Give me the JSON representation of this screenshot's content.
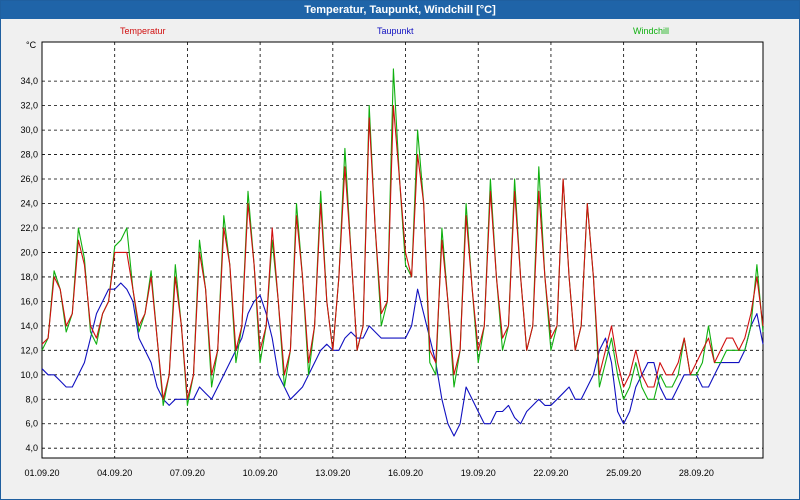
{
  "window": {
    "title": "Temperatur, Taupunkt, Windchill [°C]"
  },
  "colors": {
    "temperature": "#d01010",
    "dewpoint": "#1010c0",
    "windchill": "#10b010"
  },
  "chart_data": {
    "type": "line",
    "title": "Temperatur, Taupunkt, Windchill [°C]",
    "ylabel": "°C",
    "ylim": [
      3.2,
      37.2
    ],
    "xlim": [
      0,
      29.75
    ],
    "yticks": [
      4,
      6,
      8,
      10,
      12,
      14,
      16,
      18,
      20,
      22,
      24,
      26,
      28,
      30,
      32,
      34
    ],
    "ytick_labels": [
      "4,0",
      "6,0",
      "8,0",
      "10,0",
      "12,0",
      "14,0",
      "16,0",
      "18,0",
      "20,0",
      "22,0",
      "24,0",
      "26,0",
      "28,0",
      "30,0",
      "32,0",
      "34,0"
    ],
    "xticks": [
      0,
      3,
      6,
      9,
      12,
      15,
      18,
      21,
      24,
      27
    ],
    "xtick_labels": [
      "01.09.20",
      "04.09.20",
      "07.09.20",
      "10.09.20",
      "13.09.20",
      "16.09.20",
      "19.09.20",
      "22.09.20",
      "25.09.20",
      "28.09.20"
    ],
    "grid": true,
    "legend_position": "top",
    "series": [
      {
        "name": "Temperatur",
        "x": [
          0,
          0.25,
          0.5,
          0.75,
          1,
          1.25,
          1.5,
          1.75,
          2,
          2.25,
          2.5,
          2.75,
          3,
          3.25,
          3.5,
          3.75,
          4,
          4.25,
          4.5,
          4.75,
          5,
          5.25,
          5.5,
          5.75,
          6,
          6.25,
          6.5,
          6.75,
          7,
          7.25,
          7.5,
          7.75,
          8,
          8.25,
          8.5,
          8.75,
          9,
          9.25,
          9.5,
          9.75,
          10,
          10.25,
          10.5,
          10.75,
          11,
          11.25,
          11.5,
          11.75,
          12,
          12.25,
          12.5,
          12.75,
          13,
          13.25,
          13.5,
          13.75,
          14,
          14.25,
          14.5,
          14.75,
          15,
          15.25,
          15.5,
          15.75,
          16,
          16.25,
          16.5,
          16.75,
          17,
          17.25,
          17.5,
          17.75,
          18,
          18.25,
          18.5,
          18.75,
          19,
          19.25,
          19.5,
          19.75,
          20,
          20.25,
          20.5,
          20.75,
          21,
          21.25,
          21.5,
          21.75,
          22,
          22.25,
          22.5,
          22.75,
          23,
          23.25,
          23.5,
          23.75,
          24,
          24.25,
          24.5,
          24.75,
          25,
          25.25,
          25.5,
          25.75,
          26,
          26.25,
          26.5,
          26.75,
          27,
          27.25,
          27.5,
          27.75,
          28,
          28.25,
          28.5,
          28.75,
          29,
          29.25,
          29.5,
          29.75
        ],
        "values": [
          12.5,
          13,
          18,
          17,
          14,
          15,
          21,
          19,
          14,
          13,
          15,
          16,
          20,
          20,
          20,
          17,
          14,
          15,
          18,
          13,
          8,
          10,
          18,
          14,
          8,
          10,
          20,
          17,
          10,
          12,
          22,
          19,
          12,
          14,
          24,
          19,
          12,
          14,
          22,
          16,
          10,
          12,
          23,
          18,
          11,
          14,
          24,
          16,
          12,
          18,
          27,
          20,
          12,
          14,
          31,
          22,
          15,
          16,
          32,
          26,
          20,
          18,
          28,
          24,
          12,
          11,
          21,
          16,
          10,
          12,
          23,
          17,
          12,
          14,
          25,
          18,
          13,
          14,
          25,
          18,
          12,
          14,
          25,
          18,
          13,
          14,
          26,
          18,
          12,
          14,
          24,
          18,
          10,
          12,
          14,
          11,
          9,
          10,
          12,
          10,
          9,
          9,
          11,
          10,
          10,
          11,
          13,
          10,
          11,
          12,
          13,
          11,
          12,
          13,
          13,
          12,
          13,
          15,
          18,
          14
        ],
        "color": "#d01010"
      },
      {
        "name": "Taupunkt",
        "x": [
          0,
          0.25,
          0.5,
          0.75,
          1,
          1.25,
          1.5,
          1.75,
          2,
          2.25,
          2.5,
          2.75,
          3,
          3.25,
          3.5,
          3.75,
          4,
          4.25,
          4.5,
          4.75,
          5,
          5.25,
          5.5,
          5.75,
          6,
          6.25,
          6.5,
          6.75,
          7,
          7.25,
          7.5,
          7.75,
          8,
          8.25,
          8.5,
          8.75,
          9,
          9.25,
          9.5,
          9.75,
          10,
          10.25,
          10.5,
          10.75,
          11,
          11.25,
          11.5,
          11.75,
          12,
          12.25,
          12.5,
          12.75,
          13,
          13.25,
          13.5,
          13.75,
          14,
          14.25,
          14.5,
          14.75,
          15,
          15.25,
          15.5,
          15.75,
          16,
          16.25,
          16.5,
          16.75,
          17,
          17.25,
          17.5,
          17.75,
          18,
          18.25,
          18.5,
          18.75,
          19,
          19.25,
          19.5,
          19.75,
          20,
          20.25,
          20.5,
          20.75,
          21,
          21.25,
          21.5,
          21.75,
          22,
          22.25,
          22.5,
          22.75,
          23,
          23.25,
          23.5,
          23.75,
          24,
          24.25,
          24.5,
          24.75,
          25,
          25.25,
          25.5,
          25.75,
          26,
          26.25,
          26.5,
          26.75,
          27,
          27.25,
          27.5,
          27.75,
          28,
          28.25,
          28.5,
          28.75,
          29,
          29.25,
          29.5,
          29.75
        ],
        "values": [
          10.5,
          10,
          10,
          9.5,
          9,
          9,
          10,
          11,
          13,
          15,
          16,
          17,
          17,
          17.5,
          17,
          16,
          13,
          12,
          11,
          9,
          8,
          7.5,
          8,
          8,
          8,
          8,
          9,
          8.5,
          8,
          9,
          10,
          11,
          12,
          13,
          15,
          16,
          16.5,
          15,
          13,
          10,
          9,
          8,
          8.5,
          9,
          10,
          11,
          12,
          12.5,
          12,
          12,
          13,
          13.5,
          13,
          13,
          14,
          13.5,
          13,
          13,
          13,
          13,
          13,
          14,
          17,
          15,
          13,
          11,
          8,
          6,
          5,
          6,
          9,
          8,
          7,
          6,
          6,
          7,
          7,
          7.5,
          6.5,
          6,
          7,
          7.5,
          8,
          7.5,
          7.5,
          8,
          8.5,
          9,
          8,
          8,
          9,
          10,
          12,
          13,
          11,
          7,
          6,
          7,
          9,
          10,
          11,
          11,
          9,
          8,
          8,
          9,
          10,
          10,
          10,
          9,
          9,
          10,
          11,
          11,
          11,
          11,
          12,
          14,
          15,
          12.5
        ],
        "color": "#1010c0"
      },
      {
        "name": "Windchill",
        "x": [
          0,
          0.25,
          0.5,
          0.75,
          1,
          1.25,
          1.5,
          1.75,
          2,
          2.25,
          2.5,
          2.75,
          3,
          3.25,
          3.5,
          3.75,
          4,
          4.25,
          4.5,
          4.75,
          5,
          5.25,
          5.5,
          5.75,
          6,
          6.25,
          6.5,
          6.75,
          7,
          7.25,
          7.5,
          7.75,
          8,
          8.25,
          8.5,
          8.75,
          9,
          9.25,
          9.5,
          9.75,
          10,
          10.25,
          10.5,
          10.75,
          11,
          11.25,
          11.5,
          11.75,
          12,
          12.25,
          12.5,
          12.75,
          13,
          13.25,
          13.5,
          13.75,
          14,
          14.25,
          14.5,
          14.75,
          15,
          15.25,
          15.5,
          15.75,
          16,
          16.25,
          16.5,
          16.75,
          17,
          17.25,
          17.5,
          17.75,
          18,
          18.25,
          18.5,
          18.75,
          19,
          19.25,
          19.5,
          19.75,
          20,
          20.25,
          20.5,
          20.75,
          21,
          21.25,
          21.5,
          21.75,
          22,
          22.25,
          22.5,
          22.75,
          23,
          23.25,
          23.5,
          23.75,
          24,
          24.25,
          24.5,
          24.75,
          25,
          25.25,
          25.5,
          25.75,
          26,
          26.25,
          26.5,
          26.75,
          27,
          27.25,
          27.5,
          27.75,
          28,
          28.25,
          28.5,
          28.75,
          29,
          29.25,
          29.5,
          29.75
        ],
        "values": [
          12,
          13,
          18.5,
          17,
          13.5,
          15,
          22,
          19.5,
          13.5,
          12.5,
          15,
          16,
          20.5,
          21,
          22,
          17,
          13.5,
          15,
          18.5,
          13,
          7.5,
          10,
          19,
          14,
          7.5,
          10,
          21,
          17,
          9,
          12,
          23,
          19,
          11,
          14,
          25,
          19,
          11,
          14,
          21,
          16,
          9,
          12,
          24,
          18,
          10,
          14,
          25,
          16,
          12,
          18,
          28.5,
          20,
          12,
          14,
          32,
          22,
          14,
          16,
          35,
          26,
          19,
          18,
          30,
          24,
          11,
          10,
          22,
          16,
          9,
          12,
          24,
          17,
          11,
          14,
          26,
          18,
          12,
          14,
          26,
          18,
          12,
          14,
          27,
          18,
          12,
          14,
          26,
          18,
          12,
          14,
          24,
          18,
          9,
          11,
          13,
          10,
          8,
          9,
          11,
          9,
          8,
          8,
          10,
          9,
          9,
          10,
          13,
          10,
          10,
          11,
          14,
          11,
          11,
          12,
          12,
          12,
          12,
          14,
          19,
          13.5
        ],
        "color": "#10b010"
      }
    ]
  }
}
